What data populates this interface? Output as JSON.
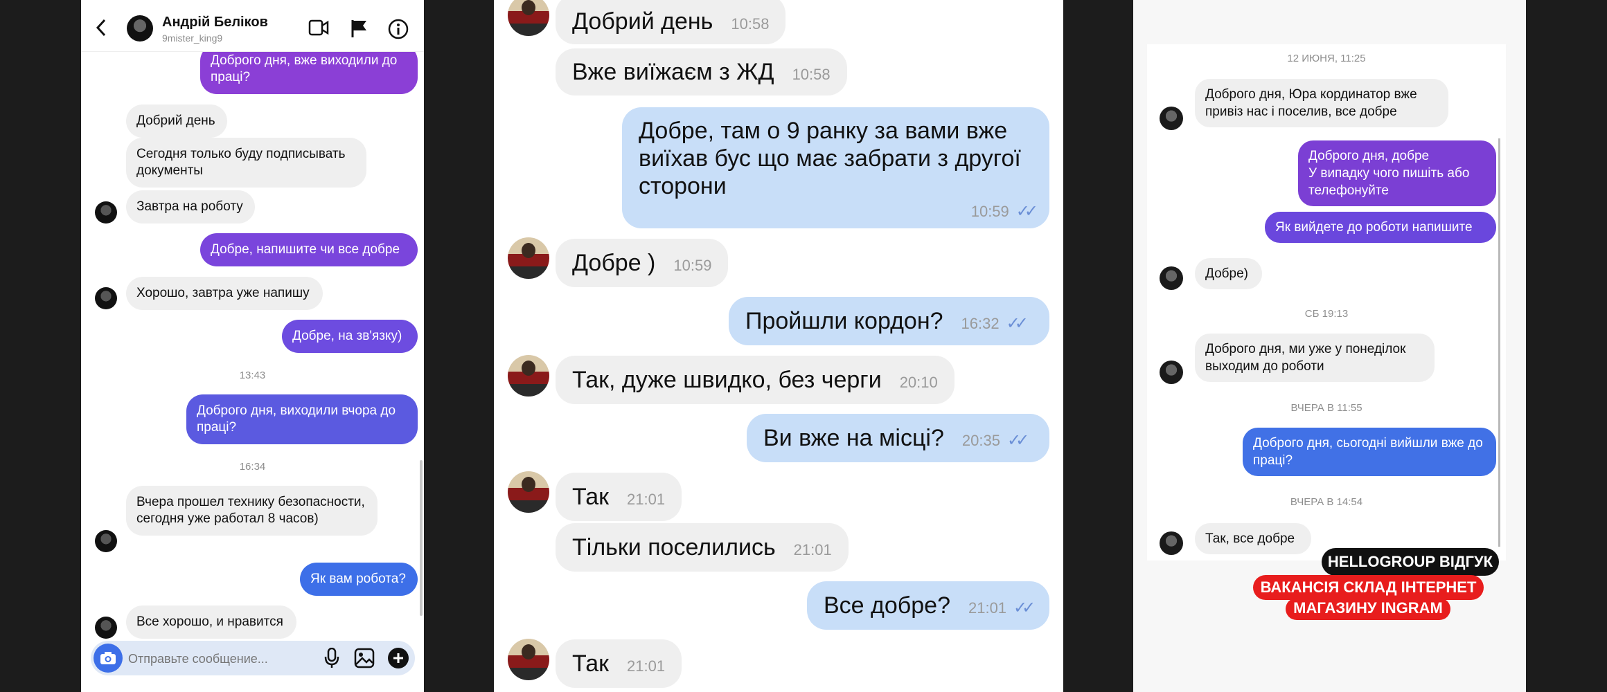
{
  "left_chat": {
    "header": {
      "name": "Андрій Беліков",
      "username": "9mister_king9"
    },
    "messages": [
      {
        "text": "Доброго дня, вже виходили до праці?"
      },
      {
        "text": "Добрий день"
      },
      {
        "text": "Сегодня только буду подписывать документы"
      },
      {
        "text": "Завтра на роботу"
      },
      {
        "text": "Добре, напишите чи все добре"
      },
      {
        "text": "Хорошо, завтра уже напишу"
      },
      {
        "text": "Добре, на зв'язку)"
      },
      {
        "time": "13:43"
      },
      {
        "text": "Доброго дня, виходили вчора до праці?"
      },
      {
        "time": "16:34"
      },
      {
        "text": "Вчера прошел технику безопасности, сегодня уже работал 8 часов)"
      },
      {
        "text": "Як вам робота?"
      },
      {
        "text": "Все хорошо, и нравится"
      }
    ],
    "composer": {
      "placeholder": "Отправьте сообщение..."
    },
    "colors": {
      "purple": "#8b3fd6",
      "violet": "#6d4ce0",
      "blue": "#3d6fe8"
    }
  },
  "middle_chat": {
    "messages": [
      {
        "text": "Добрий день",
        "time": "10:58"
      },
      {
        "text": "Вже виїжаєм з ЖД",
        "time": "10:58"
      },
      {
        "text": "Добре, там о 9 ранку за вами вже виїхав бус що має забрати з другої сторони",
        "time": "10:59"
      },
      {
        "text": "Добре )",
        "time": "10:59"
      },
      {
        "text": "Пройшли кордон?",
        "time": "16:32"
      },
      {
        "text": "Так, дуже швидко, без черги",
        "time": "20:10"
      },
      {
        "text": "Ви вже на місці?",
        "time": "20:35"
      },
      {
        "text": "Так",
        "time": "21:01"
      },
      {
        "text": "Тільки поселились",
        "time": "21:01"
      },
      {
        "text": "Все добре?",
        "time": "21:01"
      },
      {
        "text": "Так",
        "time": "21:01"
      }
    ]
  },
  "right_chat": {
    "messages": [
      {
        "date": "12 ИЮНЯ, 11:25"
      },
      {
        "text": "Доброго дня, Юра кординатор вже привіз нас і поселив, все добре"
      },
      {
        "text": "Доброго дня, добре\nУ випадку чого пишіть або телефонуйте"
      },
      {
        "text": "Як вийдете до роботи напишите"
      },
      {
        "text": "Добре)"
      },
      {
        "date": "СБ 19:13"
      },
      {
        "text": "Доброго дня, ми уже у понеділок выходим до роботи"
      },
      {
        "date": "ВЧЕРА В 11:55"
      },
      {
        "text": "Доброго дня, сьогодні вийшли вже до праці?"
      },
      {
        "date": "ВЧЕРА В 14:54"
      },
      {
        "text": "Так, все добре"
      }
    ],
    "tags": {
      "black": "HELLOGROUP ВІДГУК",
      "red_line1": "ВАКАНСІЯ СКЛАД ІНТЕРНЕТ",
      "red_line2": "МАГАЗИНУ INGRAM"
    }
  }
}
